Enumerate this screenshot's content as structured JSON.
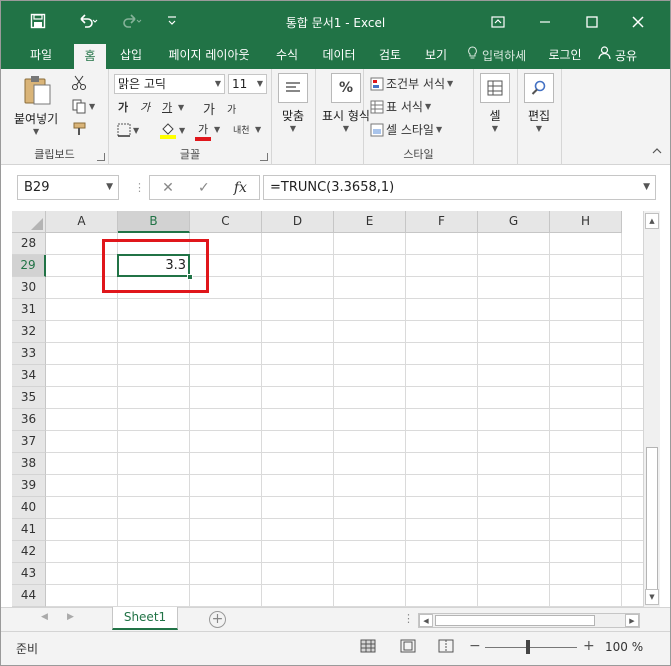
{
  "window": {
    "title": "통합 문서1 - Excel",
    "accent": "#217346"
  },
  "qat": {
    "save_icon": "save-icon",
    "undo_icon": "undo-icon",
    "redo_icon": "redo-icon",
    "customize_icon": "customize-icon"
  },
  "tabs": {
    "file": "파일",
    "home": "홈",
    "insert": "삽입",
    "page_layout": "페이지 레이아웃",
    "formulas": "수식",
    "data": "데이터",
    "review": "검토",
    "view": "보기",
    "tell_me": "입력하세",
    "login": "로그인",
    "share": "공유"
  },
  "ribbon": {
    "clipboard": {
      "label": "클립보드",
      "paste": "붙여넣기"
    },
    "font": {
      "label": "글꼴",
      "font_name": "맑은 고딕",
      "font_size": "11",
      "bold": "가",
      "italic": "가",
      "underline": "가",
      "grow": "가",
      "shrink": "가",
      "font_color": "가",
      "phonetic": "내천"
    },
    "alignment": {
      "label": "맞춤"
    },
    "number": {
      "label": "표시 형식",
      "percent": "%"
    },
    "styles": {
      "label": "스타일",
      "conditional": "조건부 서식",
      "table": "표 서식",
      "cell_style": "셀 스타일"
    },
    "cells": {
      "label": "셀"
    },
    "editing": {
      "label": "편집"
    }
  },
  "formula_bar": {
    "name_box": "B29",
    "cancel": "✕",
    "enter": "✓",
    "fx": "fx",
    "formula": "=TRUNC(3.3658,1)"
  },
  "grid": {
    "columns": [
      "A",
      "B",
      "C",
      "D",
      "E",
      "F",
      "G",
      "H"
    ],
    "rows": [
      "28",
      "29",
      "30",
      "31",
      "32",
      "33",
      "34",
      "35",
      "36",
      "37",
      "38",
      "39",
      "40",
      "41",
      "42",
      "43",
      "44"
    ],
    "selected_column": "B",
    "selected_row": "29",
    "b29_value": "3.3"
  },
  "sheets": {
    "active": "Sheet1",
    "add": "+"
  },
  "status": {
    "ready": "준비",
    "zoom": "100 %",
    "zoom_minus": "−",
    "zoom_plus": "+"
  }
}
